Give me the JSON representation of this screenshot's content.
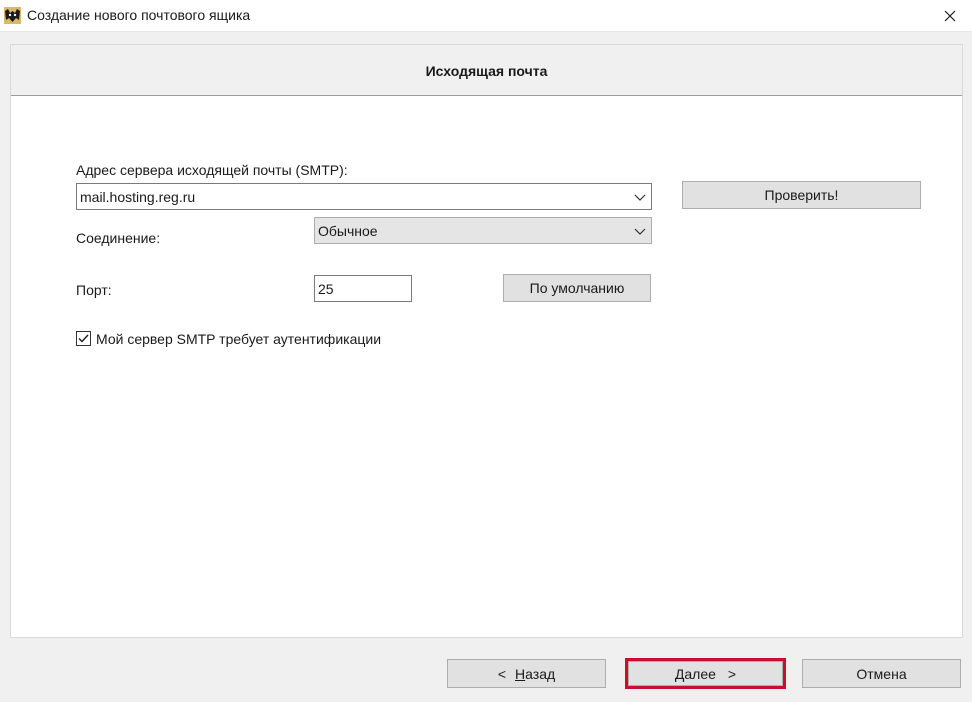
{
  "window": {
    "title": "Создание нового почтового ящика",
    "app_icon": "bat-icon",
    "close_icon": "close-icon"
  },
  "panel": {
    "title": "Исходящая почта"
  },
  "smtp": {
    "label": "Адрес сервера исходящей почты (SMTP):",
    "value": "mail.hosting.reg.ru",
    "check_button": "Проверить!"
  },
  "connection": {
    "label": "Соединение:",
    "selected": "Обычное"
  },
  "port": {
    "label": "Порт:",
    "value": "25",
    "default_button": "По умолчанию"
  },
  "auth": {
    "label": "Мой сервер SMTP требует аутентификации",
    "checked": true
  },
  "footer": {
    "back": {
      "prefix": "<",
      "hotkey": "Н",
      "rest": "азад"
    },
    "next": {
      "hotkey": "Д",
      "rest": "алее",
      "suffix": ">"
    },
    "cancel": "Отмена"
  },
  "colors": {
    "highlight": "#c8102e",
    "button_face": "#e1e1e1",
    "dialog_bg": "#f0f0f0"
  }
}
